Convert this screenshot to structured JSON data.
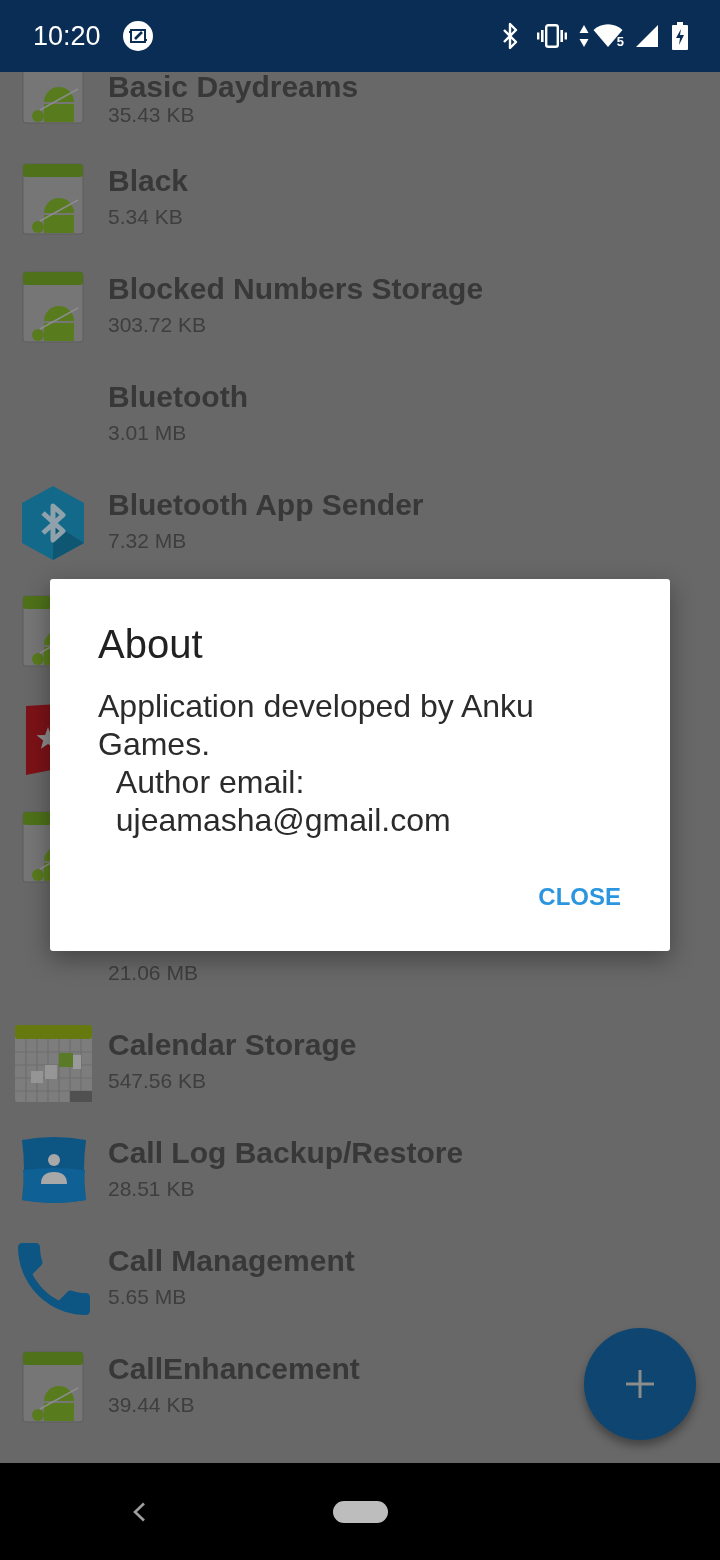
{
  "status_bar": {
    "time": "10:20",
    "wifi_label": "5"
  },
  "apps": [
    {
      "kind": "robot",
      "title": "Basic Daydreams",
      "size": "35.43 KB"
    },
    {
      "kind": "robot",
      "title": "Black",
      "size": "5.34 KB"
    },
    {
      "kind": "robot",
      "title": "Blocked Numbers Storage",
      "size": "303.72 KB"
    },
    {
      "kind": "none",
      "title": "Bluetooth",
      "size": "3.01 MB"
    },
    {
      "kind": "bluetooth",
      "title": "Bluetooth App Sender",
      "size": "7.32 MB"
    },
    {
      "kind": "robot"
    },
    {
      "kind": "bookmark"
    },
    {
      "kind": "robot"
    },
    {
      "kind": "none",
      "size": "21.06 MB"
    },
    {
      "kind": "calendar",
      "title": "Calendar Storage",
      "size": "547.56 KB"
    },
    {
      "kind": "contact",
      "title": "Call Log Backup/Restore",
      "size": "28.51 KB"
    },
    {
      "kind": "phone",
      "title": "Call Management",
      "size": "5.65 MB"
    },
    {
      "kind": "robot",
      "title": "CallEnhancement",
      "size": "39.44 KB"
    }
  ],
  "dialog": {
    "title": "About",
    "message": "Application developed by Anku Games.\n  Author email:\n  ujeamasha@gmail.com",
    "buttons": [
      "CLOSE"
    ]
  }
}
